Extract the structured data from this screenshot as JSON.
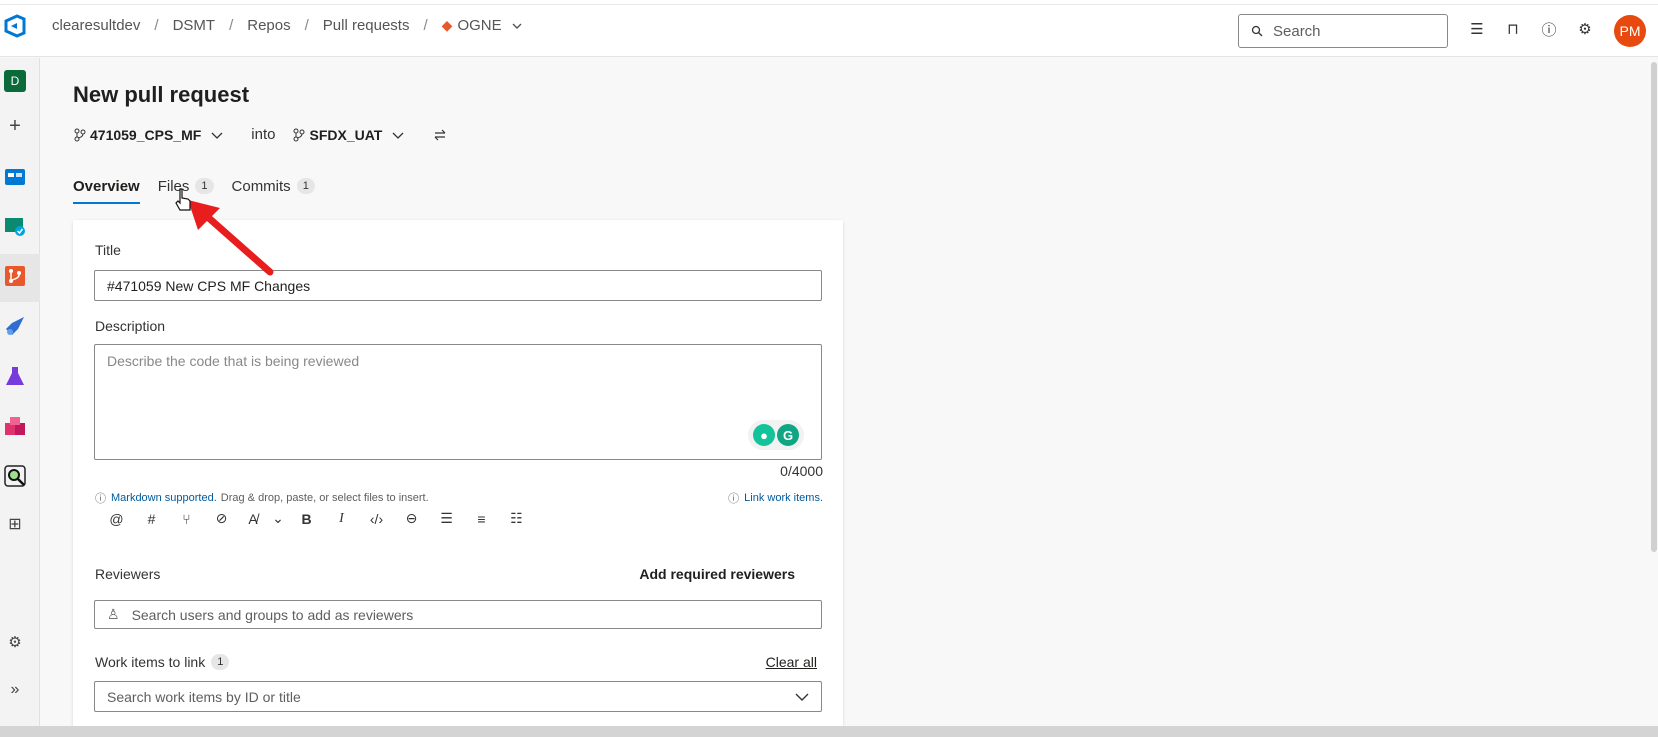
{
  "header": {
    "breadcrumbs": [
      "clearesultdev",
      "DSMT",
      "Repos",
      "Pull requests"
    ],
    "repo": "OGNE",
    "search_placeholder": "Search",
    "avatar_initials": "PM"
  },
  "rail": {
    "project_initial": "D"
  },
  "page": {
    "title": "New pull request",
    "source_branch": "471059_CPS_MF",
    "into_label": "into",
    "target_branch": "SFDX_UAT"
  },
  "tabs": [
    {
      "label": "Overview",
      "count": ""
    },
    {
      "label": "Files",
      "count": "1"
    },
    {
      "label": "Commits",
      "count": "1"
    }
  ],
  "form": {
    "title_label": "Title",
    "title_value": "#471059 New CPS MF Changes",
    "description_label": "Description",
    "description_placeholder": "Describe the code that is being reviewed",
    "char_count": "0/4000",
    "markdown_link": "Markdown supported.",
    "markdown_hint": "Drag & drop, paste, or select files to insert.",
    "link_work_items": "Link work items.",
    "reviewers_label": "Reviewers",
    "add_required_reviewers": "Add required reviewers",
    "reviewers_placeholder": "Search users and groups to add as reviewers",
    "work_items_label": "Work items to link",
    "work_items_count": "1",
    "clear_all": "Clear all",
    "work_items_placeholder": "Search work items by ID or title"
  },
  "colors": {
    "accent": "#0078d4",
    "avatar": "#e8490f",
    "annotation_arrow": "#e81e1e"
  }
}
